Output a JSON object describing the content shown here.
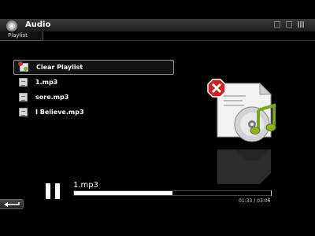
{
  "window": {
    "title": "Audio",
    "app_icon": "disc-music-icon"
  },
  "system_icons": [
    "minimize-icon",
    "display-icon",
    "signal-bars-icon"
  ],
  "tab": {
    "label": "Playlist"
  },
  "playlist": {
    "items": [
      {
        "label": "Clear Playlist",
        "icon": "clear-playlist-icon",
        "selected": true
      },
      {
        "label": "1.mp3",
        "icon": "audio-file-icon"
      },
      {
        "label": "sore.mp3",
        "icon": "audio-file-icon"
      },
      {
        "label": "I Believe.mp3",
        "icon": "audio-file-icon"
      }
    ]
  },
  "player": {
    "state": "playing",
    "control_icon": "pause-icon",
    "track_title": "1.mp3",
    "progress_fraction": 0.5,
    "time_display": "01:33 / 03:06"
  },
  "back_button": {
    "icon": "back-arrow-icon"
  },
  "colors": {
    "background": "#000000",
    "accent_error": "#d02020",
    "accent_music": "#8fb21e"
  }
}
